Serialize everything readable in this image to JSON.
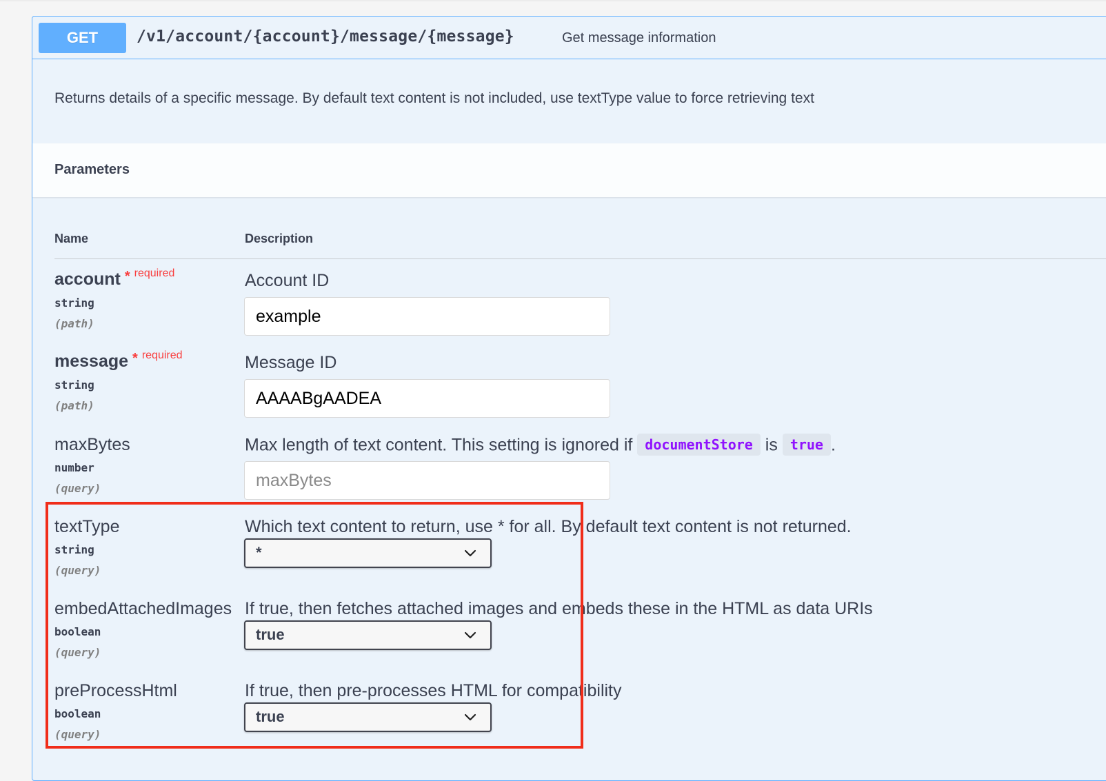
{
  "operation": {
    "method": "GET",
    "path": "/v1/account/{account}/message/{message}",
    "summary": "Get message information",
    "description": "Returns details of a specific message. By default text content is not included, use textType value to force retrieving text"
  },
  "parameters_section": {
    "title": "Parameters",
    "col_name": "Name",
    "col_description": "Description"
  },
  "required_label": "required",
  "required_star": "*",
  "params": [
    {
      "name": "account",
      "type": "string",
      "in": "(path)",
      "description": "Account ID",
      "value": "example",
      "required": true
    },
    {
      "name": "message",
      "type": "string",
      "in": "(path)",
      "description": "Message ID",
      "value": "AAAABgAADEA",
      "required": true
    },
    {
      "name": "maxBytes",
      "type": "number",
      "in": "(query)",
      "description_before": "Max length of text content. This setting is ignored if",
      "code1": "documentStore",
      "description_mid": "is",
      "code2": "true",
      "description_after": ".",
      "placeholder": "maxBytes"
    },
    {
      "name": "textType",
      "type": "string",
      "in": "(query)",
      "description": "Which text content to return, use * for all. By default text content is not returned.",
      "selected": "*"
    },
    {
      "name": "embedAttachedImages",
      "type": "boolean",
      "in": "(query)",
      "description": "If true, then fetches attached images and embeds these in the HTML as data URIs",
      "selected": "true"
    },
    {
      "name": "preProcessHtml",
      "type": "boolean",
      "in": "(query)",
      "description": "If true, then pre-processes HTML for compatibility",
      "selected": "true"
    }
  ],
  "colors": {
    "method_get": "#61affe",
    "required": "#f93e3e",
    "code": "#9012fe",
    "annotation": "#f02d1a"
  }
}
